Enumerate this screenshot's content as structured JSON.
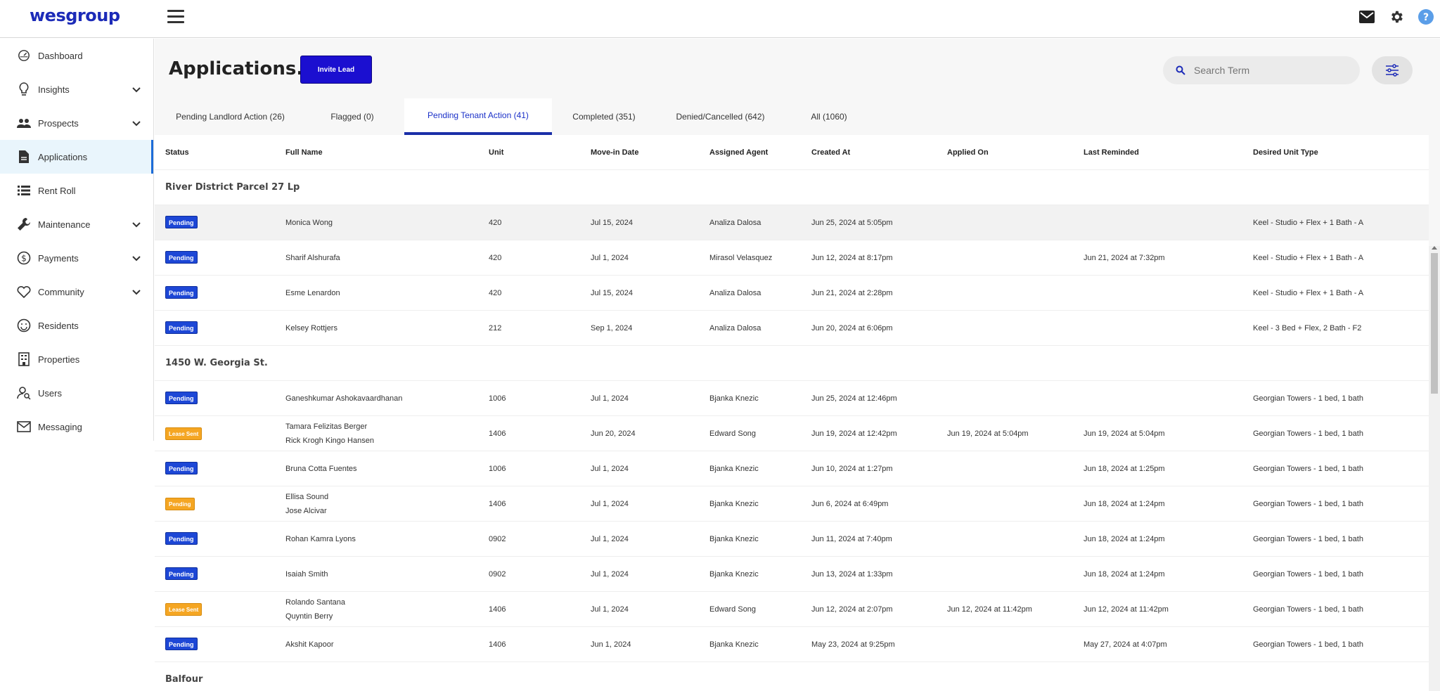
{
  "brand": {
    "logo": "wesgroup"
  },
  "sidebar": {
    "items": [
      {
        "label": "Dashboard",
        "icon": "dashboard-icon",
        "has_chevron": false,
        "active": false
      },
      {
        "label": "Insights",
        "icon": "lightbulb-icon",
        "has_chevron": true,
        "active": false
      },
      {
        "label": "Prospects",
        "icon": "people-icon",
        "has_chevron": true,
        "active": false
      },
      {
        "label": "Applications",
        "icon": "document-icon",
        "has_chevron": false,
        "active": true
      },
      {
        "label": "Rent Roll",
        "icon": "list-icon",
        "has_chevron": false,
        "active": false
      },
      {
        "label": "Maintenance",
        "icon": "wrench-icon",
        "has_chevron": true,
        "active": false
      },
      {
        "label": "Payments",
        "icon": "dollar-icon",
        "has_chevron": true,
        "active": false
      },
      {
        "label": "Community",
        "icon": "heart-icon",
        "has_chevron": true,
        "active": false
      },
      {
        "label": "Residents",
        "icon": "smile-icon",
        "has_chevron": false,
        "active": false
      },
      {
        "label": "Properties",
        "icon": "building-icon",
        "has_chevron": false,
        "active": false
      },
      {
        "label": "Users",
        "icon": "user-search-icon",
        "has_chevron": false,
        "active": false
      },
      {
        "label": "Messaging",
        "icon": "mail-icon",
        "has_chevron": false,
        "active": false
      }
    ]
  },
  "header": {
    "title": "Applications.",
    "invite_label": "Invite Lead",
    "search_placeholder": "Search Term"
  },
  "tabs": [
    {
      "label": "Pending Landlord Action (26)",
      "active": false
    },
    {
      "label": "Flagged (0)",
      "active": false
    },
    {
      "label": "Pending Tenant Action (41)",
      "active": true
    },
    {
      "label": "Completed (351)",
      "active": false
    },
    {
      "label": "Denied/Cancelled (642)",
      "active": false
    },
    {
      "label": "All (1060)",
      "active": false
    }
  ],
  "table": {
    "columns": [
      "Status",
      "Full Name",
      "Unit",
      "Move-in Date",
      "Assigned Agent",
      "Created At",
      "Applied On",
      "Last Reminded",
      "Desired Unit Type"
    ],
    "groups": [
      {
        "name": "River District Parcel 27 Lp",
        "rows": [
          {
            "status": "Pending",
            "status_type": "pending",
            "names": [
              "Monica Wong"
            ],
            "unit": "420",
            "move_in": "Jul 15, 2024",
            "agent": "Analiza Dalosa",
            "created": "Jun 25, 2024 at 5:05pm",
            "applied": "",
            "reminded": "",
            "desired": "Keel - Studio + Flex + 1 Bath - A",
            "hover": true
          },
          {
            "status": "Pending",
            "status_type": "pending",
            "names": [
              "Sharif Alshurafa"
            ],
            "unit": "420",
            "move_in": "Jul 1, 2024",
            "agent": "Mirasol Velasquez",
            "created": "Jun 12, 2024 at 8:17pm",
            "applied": "",
            "reminded": "Jun 21, 2024 at 7:32pm",
            "desired": "Keel - Studio + Flex + 1 Bath - A"
          },
          {
            "status": "Pending",
            "status_type": "pending",
            "names": [
              "Esme Lenardon"
            ],
            "unit": "420",
            "move_in": "Jul 15, 2024",
            "agent": "Analiza Dalosa",
            "created": "Jun 21, 2024 at 2:28pm",
            "applied": "",
            "reminded": "",
            "desired": "Keel - Studio + Flex + 1 Bath - A"
          },
          {
            "status": "Pending",
            "status_type": "pending",
            "names": [
              "Kelsey Rottjers"
            ],
            "unit": "212",
            "move_in": "Sep 1, 2024",
            "agent": "Analiza Dalosa",
            "created": "Jun 20, 2024 at 6:06pm",
            "applied": "",
            "reminded": "",
            "desired": "Keel - 3 Bed + Flex, 2 Bath - F2"
          }
        ]
      },
      {
        "name": "1450 W. Georgia St.",
        "rows": [
          {
            "status": "Pending",
            "status_type": "pending",
            "names": [
              "Ganeshkumar Ashokavaardhanan"
            ],
            "unit": "1006",
            "move_in": "Jul 1, 2024",
            "agent": "Bjanka Knezic",
            "created": "Jun 25, 2024 at 12:46pm",
            "applied": "",
            "reminded": "",
            "desired": "Georgian Towers - 1 bed, 1 bath"
          },
          {
            "status": "Lease Sent",
            "status_type": "lease",
            "names": [
              "Tamara Felizitas Berger",
              "Rick Krogh Kingo Hansen"
            ],
            "unit": "1406",
            "move_in": "Jun 20, 2024",
            "agent": "Edward Song",
            "created": "Jun 19, 2024 at 12:42pm",
            "applied": "Jun 19, 2024 at 5:04pm",
            "reminded": "Jun 19, 2024 at 5:04pm",
            "desired": "Georgian Towers - 1 bed, 1 bath"
          },
          {
            "status": "Pending",
            "status_type": "pending",
            "names": [
              "Bruna Cotta Fuentes"
            ],
            "unit": "1006",
            "move_in": "Jul 1, 2024",
            "agent": "Bjanka Knezic",
            "created": "Jun 10, 2024 at 1:27pm",
            "applied": "",
            "reminded": "Jun 18, 2024 at 1:25pm",
            "desired": "Georgian Towers - 1 bed, 1 bath"
          },
          {
            "status": "Pending",
            "status_type": "lease",
            "names": [
              "Ellisa Sound",
              "Jose Alcivar"
            ],
            "unit": "1406",
            "move_in": "Jul 1, 2024",
            "agent": "Bjanka Knezic",
            "created": "Jun 6, 2024 at 6:49pm",
            "applied": "",
            "reminded": "Jun 18, 2024 at 1:24pm",
            "desired": "Georgian Towers - 1 bed, 1 bath"
          },
          {
            "status": "Pending",
            "status_type": "pending",
            "names": [
              "Rohan Kamra Lyons"
            ],
            "unit": "0902",
            "move_in": "Jul 1, 2024",
            "agent": "Bjanka Knezic",
            "created": "Jun 11, 2024 at 7:40pm",
            "applied": "",
            "reminded": "Jun 18, 2024 at 1:24pm",
            "desired": "Georgian Towers - 1 bed, 1 bath"
          },
          {
            "status": "Pending",
            "status_type": "pending",
            "names": [
              "Isaiah Smith"
            ],
            "unit": "0902",
            "move_in": "Jul 1, 2024",
            "agent": "Bjanka Knezic",
            "created": "Jun 13, 2024 at 1:33pm",
            "applied": "",
            "reminded": "Jun 18, 2024 at 1:24pm",
            "desired": "Georgian Towers - 1 bed, 1 bath"
          },
          {
            "status": "Lease Sent",
            "status_type": "lease",
            "names": [
              "Rolando Santana",
              "Quyntin Berry"
            ],
            "unit": "1406",
            "move_in": "Jul 1, 2024",
            "agent": "Edward Song",
            "created": "Jun 12, 2024 at 2:07pm",
            "applied": "Jun 12, 2024 at 11:42pm",
            "reminded": "Jun 12, 2024 at 11:42pm",
            "desired": "Georgian Towers - 1 bed, 1 bath"
          },
          {
            "status": "Pending",
            "status_type": "pending",
            "names": [
              "Akshit Kapoor"
            ],
            "unit": "1406",
            "move_in": "Jun 1, 2024",
            "agent": "Bjanka Knezic",
            "created": "May 23, 2024 at 9:25pm",
            "applied": "",
            "reminded": "May 27, 2024 at 4:07pm",
            "desired": "Georgian Towers - 1 bed, 1 bath"
          }
        ]
      },
      {
        "name": "Balfour",
        "rows": []
      }
    ]
  },
  "colors": {
    "brand": "#1c2bb8",
    "accent": "#1b0fd0",
    "pending": "#1d47d6",
    "lease_sent": "#f5a623"
  }
}
